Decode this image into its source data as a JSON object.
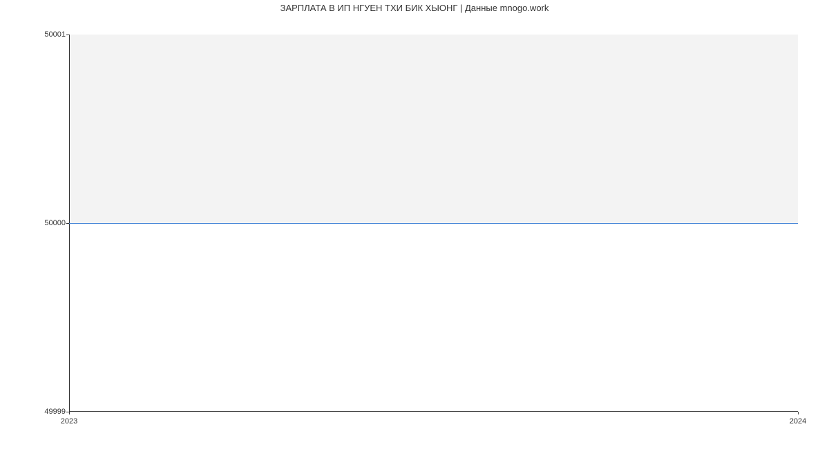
{
  "chart_data": {
    "type": "line",
    "title": "ЗАРПЛАТА В ИП НГУЕН ТХИ БИК ХЫОНГ | Данные mnogo.work",
    "xlabel": "",
    "ylabel": "",
    "x": [
      2023,
      2024
    ],
    "values": [
      50000,
      50000
    ],
    "ylim": [
      49999,
      50001
    ],
    "xlim": [
      2023,
      2024
    ],
    "y_ticks": [
      49999,
      50000,
      50001
    ],
    "x_ticks": [
      2023,
      2024
    ]
  }
}
